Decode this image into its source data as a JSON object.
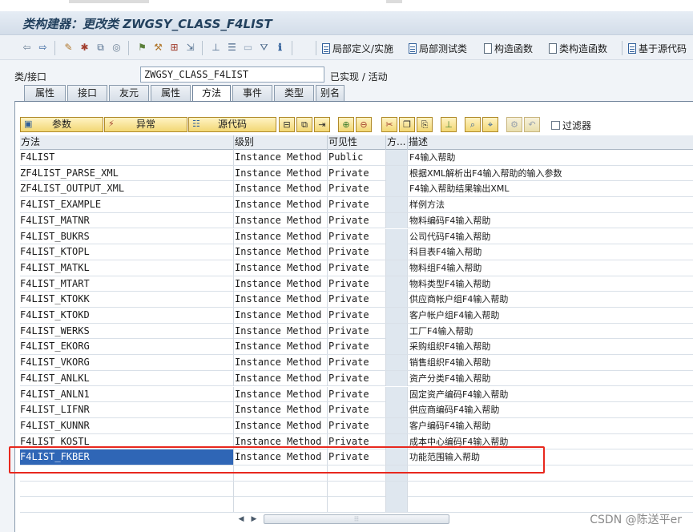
{
  "window": {
    "title": "类构建器：更改类 ZWGSY_CLASS_F4LIST"
  },
  "app_toolbar": {
    "icons": [
      "back-arrow-icon",
      "forward-arrow-icon",
      "other-object-icon",
      "display-change-icon",
      "activate-icon",
      "check-icon",
      "where-used-icon",
      "test-icon",
      "hierarchy-icon",
      "list-icon",
      "window-icon",
      "filter-icon",
      "info-icon"
    ],
    "buttons": [
      {
        "label": "局部定义/实施"
      },
      {
        "label": "局部测试类"
      },
      {
        "label": "构造函数"
      },
      {
        "label": "类构造函数"
      },
      {
        "label": "基于源代码"
      }
    ]
  },
  "class_row": {
    "label": "类/接口",
    "value": "ZWGSY_CLASS_F4LIST",
    "status": "已实现 / 活动"
  },
  "tabs": [
    {
      "label": "属性",
      "active": false
    },
    {
      "label": "接口",
      "active": false
    },
    {
      "label": "友元",
      "active": false
    },
    {
      "label": "属性",
      "active": false
    },
    {
      "label": "方法",
      "active": true
    },
    {
      "label": "事件",
      "active": false
    },
    {
      "label": "类型",
      "active": false
    },
    {
      "label": "别名",
      "active": false
    }
  ],
  "method_toolbar": {
    "param_label": "参数",
    "exception_label": "异常",
    "source_label": "源代码",
    "filter_label": "过滤器"
  },
  "grid": {
    "headers": {
      "name": "方法",
      "level": "级别",
      "visibility": "可见性",
      "m": "方...",
      "desc": "描述"
    },
    "rows": [
      {
        "name": "F4LIST",
        "level": "Instance Method",
        "visibility": "Public",
        "desc": "F4输入帮助"
      },
      {
        "name": "ZF4LIST_PARSE_XML",
        "level": "Instance Method",
        "visibility": "Private",
        "desc": "根据XML解析出F4输入帮助的输入参数"
      },
      {
        "name": "ZF4LIST_OUTPUT_XML",
        "level": "Instance Method",
        "visibility": "Private",
        "desc": "F4输入帮助结果输出XML"
      },
      {
        "name": "F4LIST_EXAMPLE",
        "level": "Instance Method",
        "visibility": "Private",
        "desc": "样例方法"
      },
      {
        "name": "F4LIST_MATNR",
        "level": "Instance Method",
        "visibility": "Private",
        "desc": "物料编码F4输入帮助"
      },
      {
        "name": "F4LIST_BUKRS",
        "level": "Instance Method",
        "visibility": "Private",
        "desc": "公司代码F4输入帮助"
      },
      {
        "name": "F4LIST_KTOPL",
        "level": "Instance Method",
        "visibility": "Private",
        "desc": "科目表F4输入帮助"
      },
      {
        "name": "F4LIST_MATKL",
        "level": "Instance Method",
        "visibility": "Private",
        "desc": "物料组F4输入帮助"
      },
      {
        "name": "F4LIST_MTART",
        "level": "Instance Method",
        "visibility": "Private",
        "desc": "物料类型F4输入帮助"
      },
      {
        "name": "F4LIST_KTOKK",
        "level": "Instance Method",
        "visibility": "Private",
        "desc": "供应商帐户组F4输入帮助"
      },
      {
        "name": "F4LIST_KTOKD",
        "level": "Instance Method",
        "visibility": "Private",
        "desc": "客户帐户组F4输入帮助"
      },
      {
        "name": "F4LIST_WERKS",
        "level": "Instance Method",
        "visibility": "Private",
        "desc": "工厂F4输入帮助"
      },
      {
        "name": "F4LIST_EKORG",
        "level": "Instance Method",
        "visibility": "Private",
        "desc": "采购组织F4输入帮助"
      },
      {
        "name": "F4LIST_VKORG",
        "level": "Instance Method",
        "visibility": "Private",
        "desc": "销售组织F4输入帮助"
      },
      {
        "name": "F4LIST_ANLKL",
        "level": "Instance Method",
        "visibility": "Private",
        "desc": "资产分类F4输入帮助"
      },
      {
        "name": "F4LIST_ANLN1",
        "level": "Instance Method",
        "visibility": "Private",
        "desc": "固定资产编码F4输入帮助"
      },
      {
        "name": "F4LIST_LIFNR",
        "level": "Instance Method",
        "visibility": "Private",
        "desc": "供应商编码F4输入帮助"
      },
      {
        "name": "F4LIST_KUNNR",
        "level": "Instance Method",
        "visibility": "Private",
        "desc": "客户编码F4输入帮助"
      },
      {
        "name": "F4LIST_KOSTL",
        "level": "Instance Method",
        "visibility": "Private",
        "desc": "成本中心编码F4输入帮助"
      },
      {
        "name": "F4LIST_FKBER",
        "level": "Instance Method",
        "visibility": "Private",
        "desc": "功能范围输入帮助",
        "selected": true
      }
    ],
    "empty_rows": 3
  },
  "watermark": "CSDN @陈送平er",
  "colors": {
    "selection": "#2f66b6",
    "highlight_box": "#e8281e",
    "title_text": "#23415e"
  }
}
